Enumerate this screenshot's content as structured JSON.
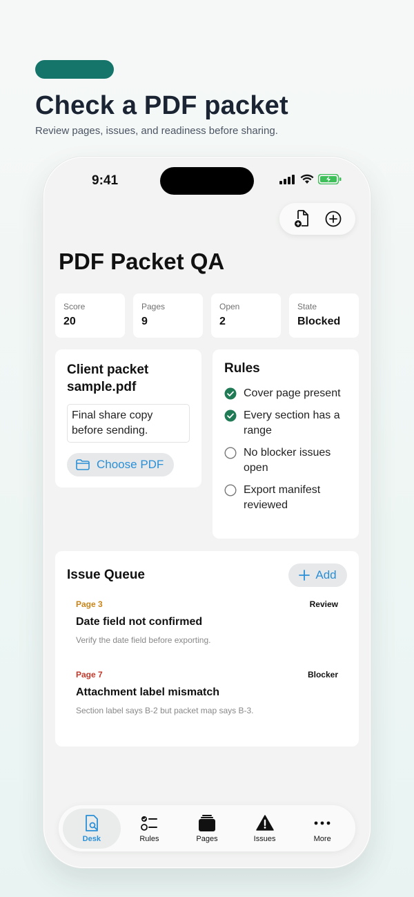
{
  "hero": {
    "title": "Check a PDF packet",
    "subtitle": "Review pages, issues, and readiness before sharing."
  },
  "status": {
    "time": "9:41"
  },
  "app": {
    "title": "PDF Packet QA"
  },
  "stats": [
    {
      "label": "Score",
      "value": "20"
    },
    {
      "label": "Pages",
      "value": "9"
    },
    {
      "label": "Open",
      "value": "2"
    },
    {
      "label": "State",
      "value": "Blocked"
    }
  ],
  "file": {
    "name": "Client packet sample.pdf",
    "note": "Final share copy before sending.",
    "choose_label": "Choose PDF"
  },
  "rules": {
    "title": "Rules",
    "items": [
      {
        "label": "Cover page present",
        "checked": true
      },
      {
        "label": "Every section has a range",
        "checked": true
      },
      {
        "label": "No blocker issues open",
        "checked": false
      },
      {
        "label": "Export manifest reviewed",
        "checked": false
      }
    ]
  },
  "queue": {
    "title": "Issue Queue",
    "add_label": "Add",
    "issues": [
      {
        "page": "Page 3",
        "tag": "Review",
        "title": "Date field not confirmed",
        "desc": "Verify the date field before exporting.",
        "color": "#c8841a"
      },
      {
        "page": "Page 7",
        "tag": "Blocker",
        "title": "Attachment label mismatch",
        "desc": "Section label says B-2 but packet map says B-3.",
        "color": "#c0392b"
      }
    ]
  },
  "tabs": [
    {
      "label": "Desk",
      "icon": "desk-search-icon",
      "active": true
    },
    {
      "label": "Rules",
      "icon": "checklist-icon",
      "active": false
    },
    {
      "label": "Pages",
      "icon": "pages-stack-icon",
      "active": false
    },
    {
      "label": "Issues",
      "icon": "warning-icon",
      "active": false
    },
    {
      "label": "More",
      "icon": "more-dots-icon",
      "active": false
    }
  ],
  "colors": {
    "accent": "#2b8fd6",
    "brand": "#16756a",
    "check": "#1f7a55"
  }
}
